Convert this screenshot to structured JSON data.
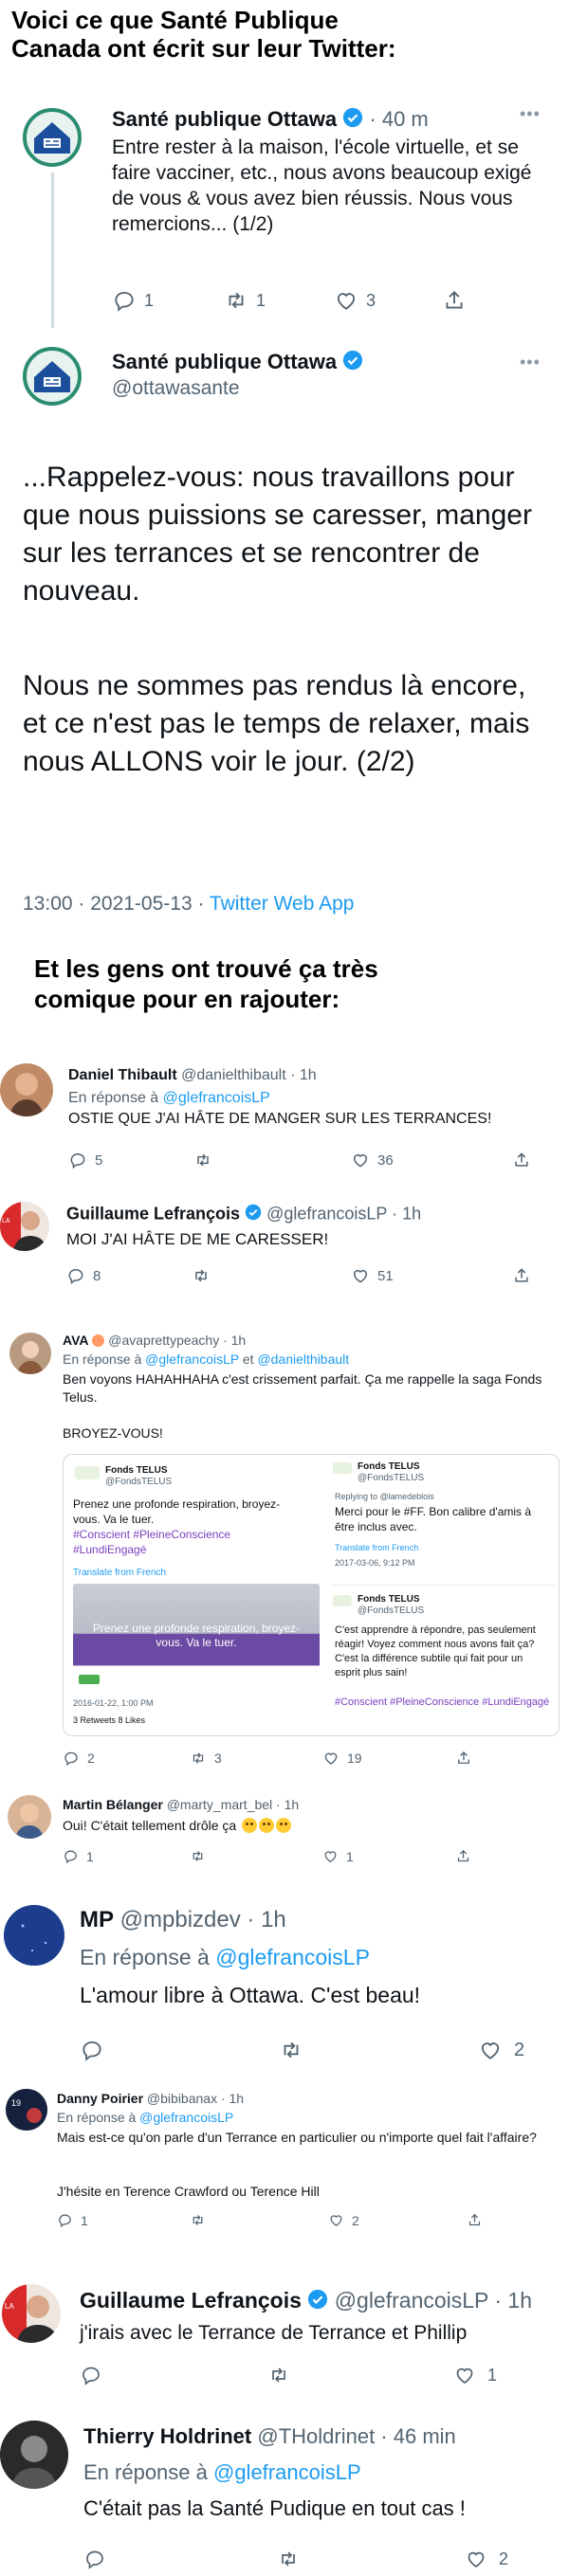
{
  "captions": {
    "top_line1": "Voici ce que Santé Publique",
    "top_line2": "Canada ont écrit sur leur Twitter:",
    "middle_line1": "Et les gens ont trouvé ça très",
    "middle_line2": "comique pour en rajouter:"
  },
  "tweet1": {
    "name": "Santé publique Ottawa",
    "time": "· 40 m",
    "text": "Entre rester à la maison, l'école virtuelle, et se faire vacciner, etc., nous avons beaucoup exigé de vous & vous avez bien réussis. Nous vous remercions... (1/2)",
    "replies": "1",
    "retweets": "1",
    "likes": "3"
  },
  "tweet2": {
    "name": "Santé publique Ottawa",
    "handle": "@ottawasante",
    "para1": "...Rappelez-vous: nous travaillons pour que nous puissions se caresser, manger sur les terrances et se rencontrer de nouveau.",
    "para2": "Nous ne sommes pas rendus là encore, et ce n'est pas le temps de relaxer, mais nous ALLONS voir le jour. (2/2)",
    "meta_time": "13:00 · 2021-05-13 · ",
    "meta_app": "Twitter Web App"
  },
  "replies": [
    {
      "name": "Daniel Thibault",
      "handle": "@danielthibault · 1h",
      "reply_prefix": "En réponse à ",
      "reply_to": "@glefrancoisLP",
      "text": "OSTIE QUE J'AI HÂTE DE MANGER SUR LES TERRANCES!",
      "replies": "5",
      "likes": "36"
    },
    {
      "name": "Guillaume Lefrançois",
      "handle": "@glefrancoisLP · 1h",
      "text": "MOI J'AI HÂTE DE ME CARESSER!",
      "replies": "8",
      "likes": "51"
    },
    {
      "name": "AVA",
      "handle": "@avaprettypeachy · 1h",
      "reply_prefix": "En réponse à ",
      "reply_to": "@glefrancoisLP",
      "reply_and": " et ",
      "reply_to2": "@danielthibault",
      "text": "Ben voyons HAHAHHAHA c'est crissement parfait. Ça me rappelle la saga Fonds Telus.",
      "text2": "BROYEZ-VOUS!",
      "replies": "2",
      "retweets": "3",
      "likes": "19"
    },
    {
      "name": "Martin Bélanger",
      "handle": "@marty_mart_bel · 1h",
      "text": "Oui! C'était tellement drôle ça",
      "replies": "1",
      "likes": "1"
    },
    {
      "name": "MP",
      "handle": "@mpbizdev · 1h",
      "reply_prefix": "En réponse à ",
      "reply_to": "@glefrancoisLP",
      "text": "L'amour libre à Ottawa. C'est beau!",
      "likes": "2"
    },
    {
      "name": "Danny Poirier",
      "handle": "@bibibanax · 1h",
      "reply_prefix": "En réponse à ",
      "reply_to": "@glefrancoisLP",
      "text": "Mais est-ce qu'on parle d'un Terrance en particulier ou n'importe quel fait l'affaire?",
      "text2": "J'hésite en Terence Crawford ou Terence Hill",
      "replies": "1",
      "likes": "2"
    },
    {
      "name": "Guillaume Lefrançois",
      "handle": "@glefrancoisLP · 1h",
      "text": "j'irais avec le Terrance de Terrance et Phillip",
      "likes": "1"
    },
    {
      "name": "Thierry Holdrinet",
      "handle": "@THoldrinet · 46 min",
      "reply_prefix": "En réponse à ",
      "reply_to": "@glefrancoisLP",
      "text": "C'était pas la Santé Pudique en tout cas !",
      "likes": "2"
    }
  ],
  "embed": {
    "left": {
      "name": "Fonds TELUS",
      "handle": "@FondsTELUS",
      "text": "Prenez une profonde respiration, broyez-vous. Va le tuer.",
      "hashtags": "#Conscient #PleineConscience #LundiEngagé",
      "translate": "Translate from French",
      "image_text": "Prenez une profonde respiration, broyez-vous. Va le tuer.",
      "date": "2016-01-22, 1:00 PM",
      "stats": "3 Retweets  8 Likes"
    },
    "right_top": {
      "name": "Fonds TELUS",
      "handle": "@FondsTELUS",
      "replying": "Replying to @lamedeblois",
      "text": "Merci pour le #FF. Bon calibre d'amis à être inclus avec.",
      "translate": "Translate from French",
      "date": "2017-03-06, 9:12 PM"
    },
    "right_bottom": {
      "name": "Fonds TELUS",
      "handle": "@FondsTELUS",
      "text": "C'est apprendre à répondre, pas seulement réagir! Voyez comment nous avons fait ça? C'est la différence subtile qui fait pour un esprit plus sain!",
      "hashtags": "#Conscient #PleineConscience #LundiEngagé"
    }
  },
  "colors": {
    "link": "#1d9bf0",
    "muted": "#536471",
    "like": "#536471"
  }
}
